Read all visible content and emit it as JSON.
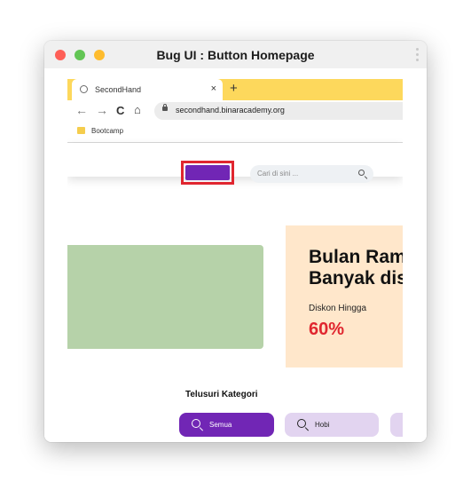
{
  "window": {
    "title": "Bug UI : Button Homepage"
  },
  "browser": {
    "tab": {
      "title": "SecondHand",
      "close": "×"
    },
    "new_tab": "+",
    "nav": {
      "back": "←",
      "forward": "→",
      "reload": "C",
      "home": "⌂"
    },
    "url": "secondhand.binaracademy.org",
    "bookmark": "Bootcamp"
  },
  "page": {
    "search": {
      "placeholder": "Cari di sini ..."
    },
    "banner": {
      "heading_line1": "Bulan Ram",
      "heading_line2": "Banyak dis",
      "discount_label": "Diskon Hingga",
      "discount_value": "60%"
    },
    "categories": {
      "title": "Telusuri Kategori",
      "items": [
        "Semua",
        "Hobi"
      ]
    }
  },
  "colors": {
    "accent_purple": "#7126b5",
    "highlight_red": "#e0262f",
    "tab_yellow": "#fdd85c",
    "banner_green": "#b6d2a9",
    "promo_bg": "#ffe7cb",
    "chip_light": "#e2d4f0"
  }
}
